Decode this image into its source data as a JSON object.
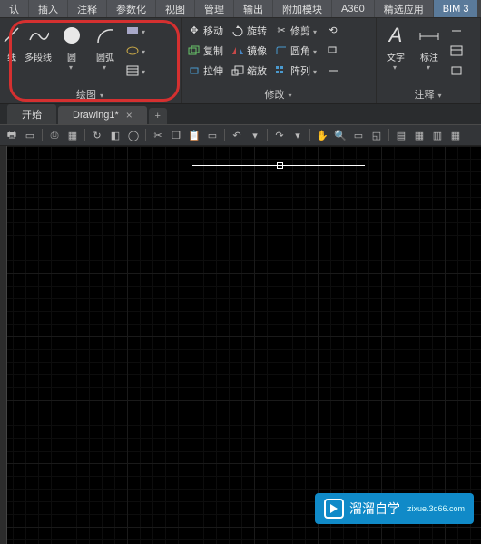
{
  "menu": [
    "认",
    "插入",
    "注释",
    "参数化",
    "视图",
    "管理",
    "输出",
    "附加模块",
    "A360",
    "精选应用",
    "BIM 3"
  ],
  "ribbon": {
    "draw": {
      "xian": "线",
      "polyline": "多段线",
      "circle": "圆",
      "arc": "圆弧",
      "footer": "绘图"
    },
    "modify": {
      "move": "移动",
      "copy": "复制",
      "stretch": "拉伸",
      "rotate": "旋转",
      "mirror": "镜像",
      "scale": "缩放",
      "trim": "修剪",
      "fillet": "圆角",
      "array": "阵列",
      "footer": "修改"
    },
    "annotate": {
      "text": "文字",
      "dim": "标注",
      "footer": "注释"
    }
  },
  "tabs": {
    "start": "开始",
    "current": "Drawing1*"
  },
  "watermark": {
    "brand": "溜溜自学",
    "sub": "zixue.3d66.com"
  }
}
